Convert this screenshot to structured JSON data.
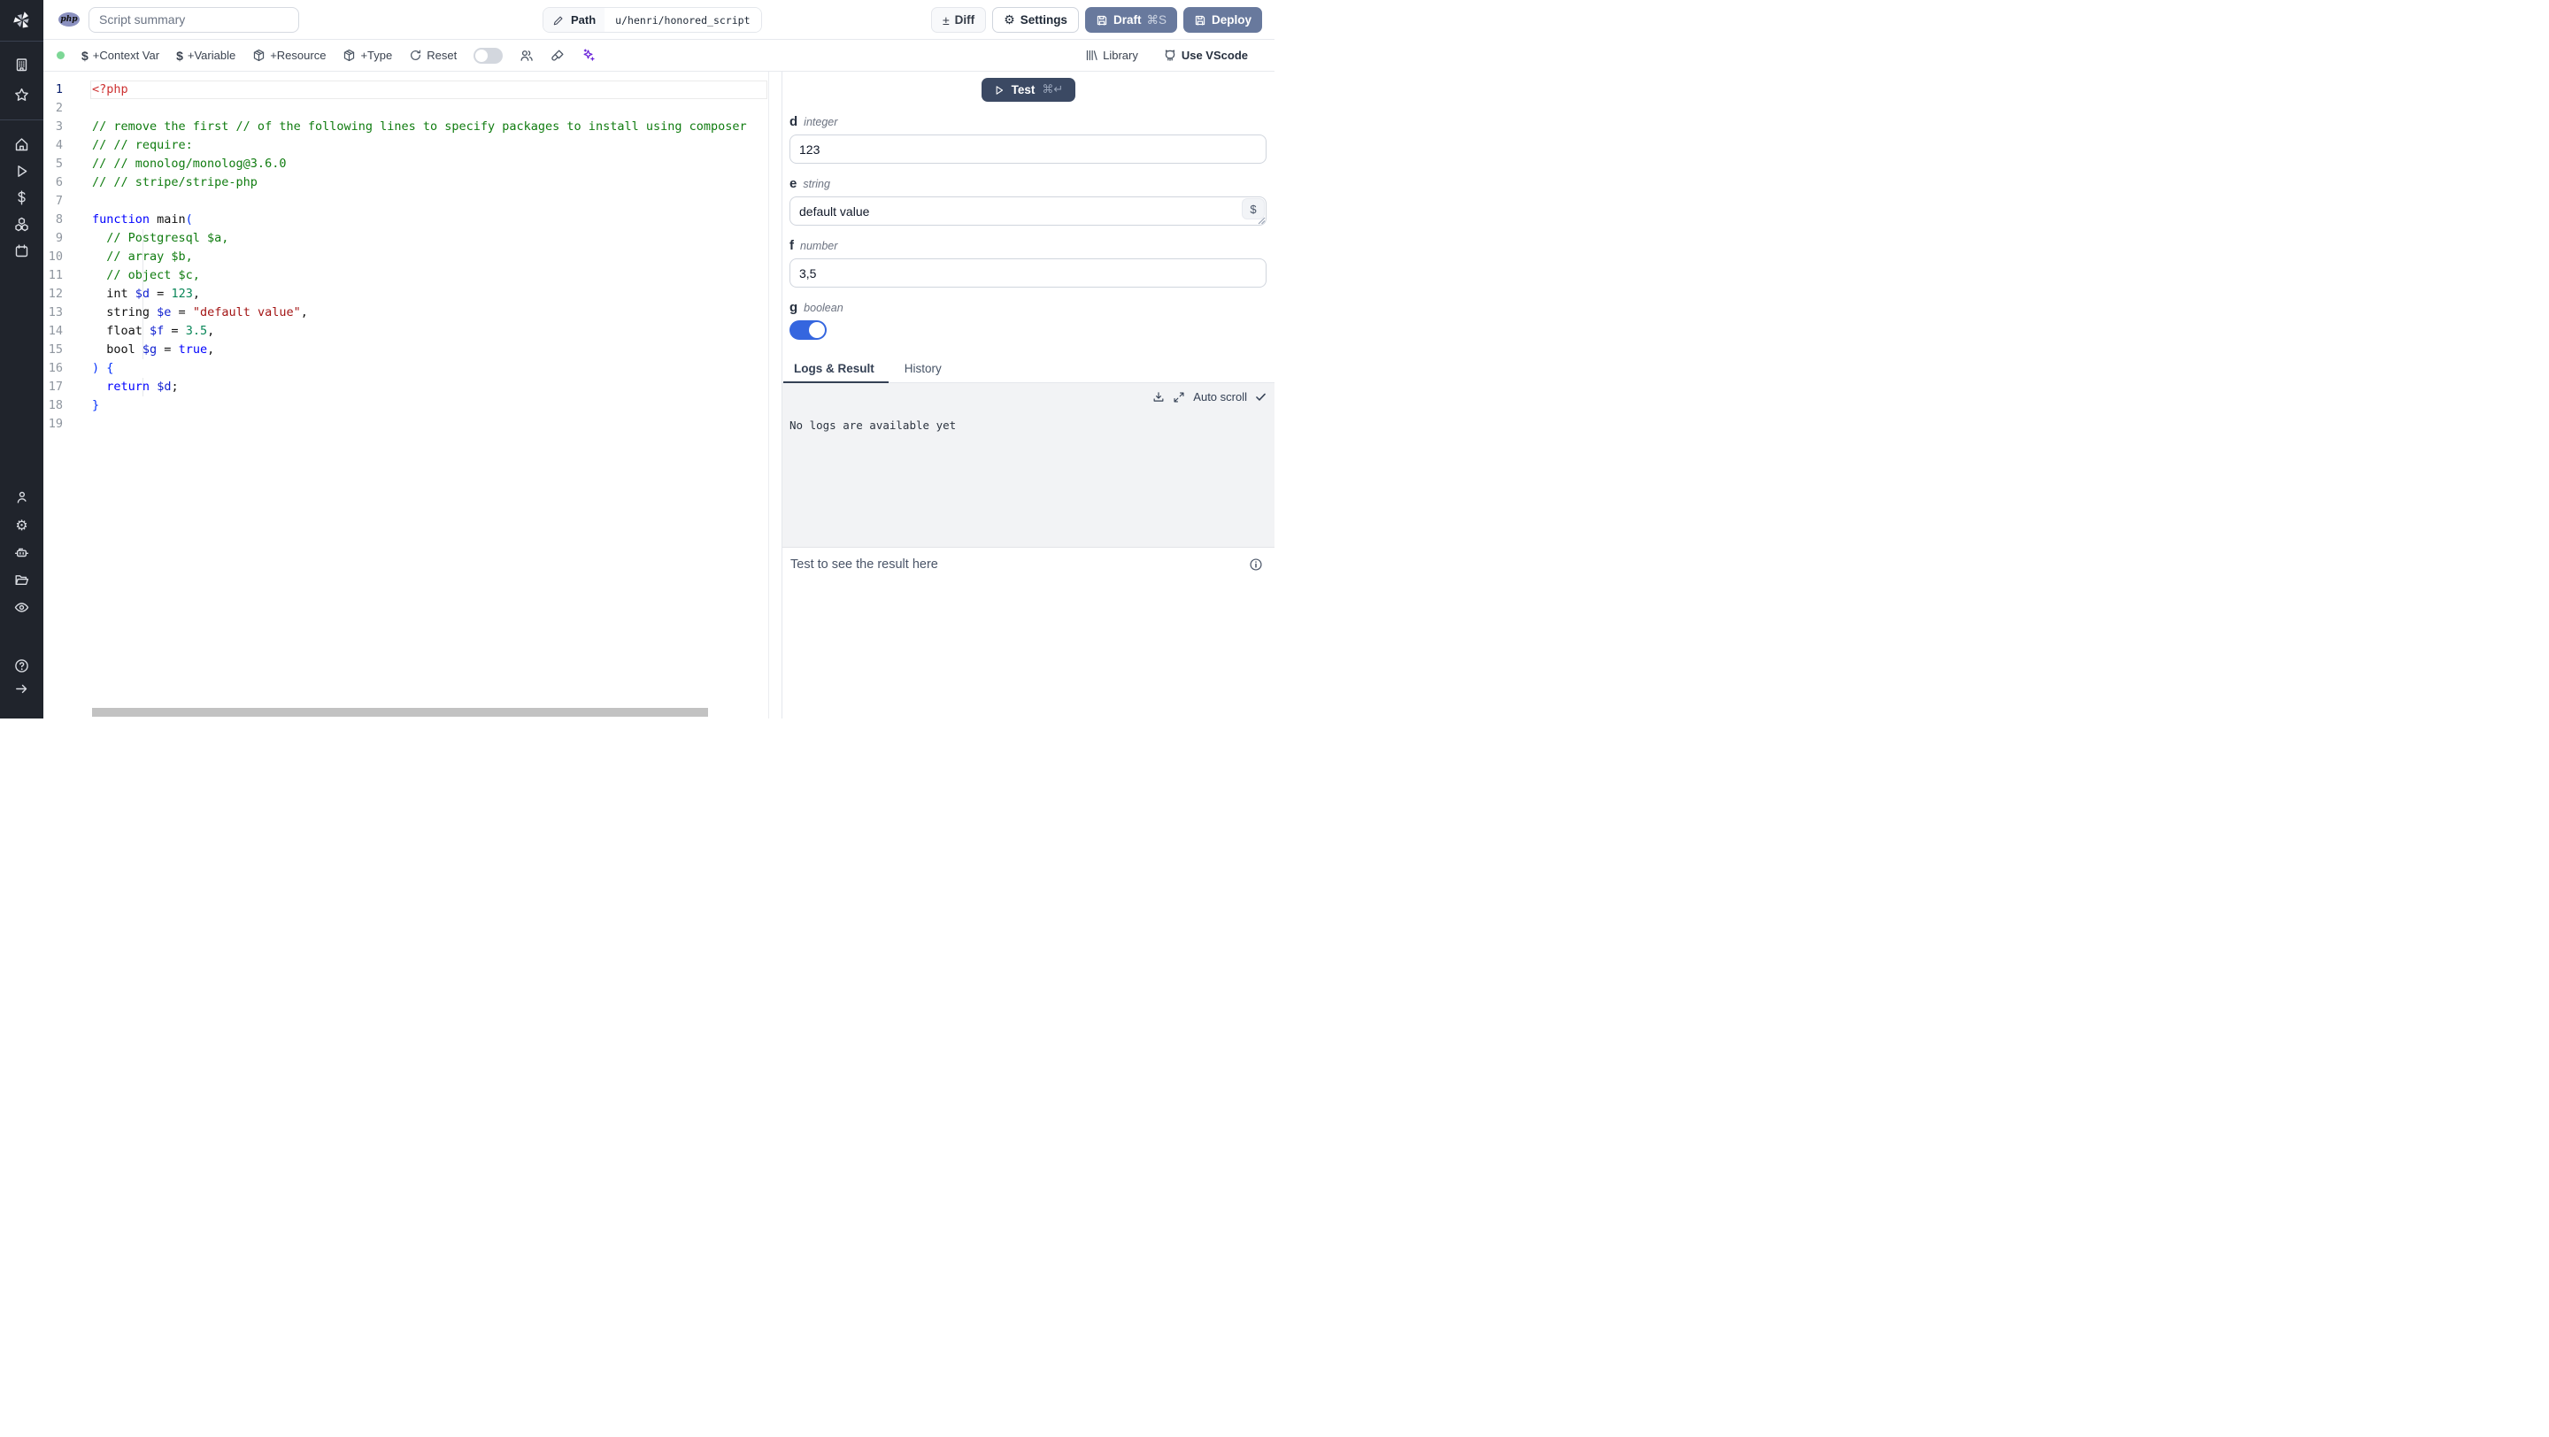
{
  "header": {
    "language_badge": "php",
    "summary_placeholder": "Script summary",
    "path_label": "Path",
    "path_value": "u/henri/honored_script",
    "diff_label": "Diff",
    "settings_label": "Settings",
    "draft_label": "Draft",
    "draft_shortcut": "⌘S",
    "deploy_label": "Deploy"
  },
  "toolbar": {
    "add_context_var": "+Context Var",
    "add_variable": "+Variable",
    "add_resource": "+Resource",
    "add_type": "+Type",
    "reset": "Reset",
    "library": "Library",
    "use_vscode": "Use VScode"
  },
  "sidebar": {
    "icons": [
      "windmill-logo",
      "workspace-building",
      "favorites-star",
      "home",
      "runs-play",
      "variables-dollar",
      "resources-cubes",
      "schedules-calendar",
      "user",
      "settings-gear",
      "workers-robot",
      "folders",
      "audit-eye",
      "help-question",
      "collapse-arrow-right"
    ]
  },
  "editor": {
    "language": "php",
    "lines": [
      {
        "n": 1,
        "s": [
          [
            "<?php",
            "tag"
          ]
        ]
      },
      {
        "n": 2,
        "s": []
      },
      {
        "n": 3,
        "s": [
          [
            "// remove the first // of the following lines to specify packages to install using composer",
            "cm"
          ]
        ]
      },
      {
        "n": 4,
        "s": [
          [
            "// // require:",
            "cm"
          ]
        ]
      },
      {
        "n": 5,
        "s": [
          [
            "// // monolog/monolog@3.6.0",
            "cm"
          ]
        ]
      },
      {
        "n": 6,
        "s": [
          [
            "// // stripe/stripe-php",
            "cm"
          ]
        ]
      },
      {
        "n": 7,
        "s": []
      },
      {
        "n": 8,
        "s": [
          [
            "function",
            "kw"
          ],
          [
            " main",
            "pl"
          ],
          [
            "(",
            "br"
          ]
        ]
      },
      {
        "n": 9,
        "s": [
          [
            "  // Postgresql $a,",
            "cm"
          ]
        ]
      },
      {
        "n": 10,
        "s": [
          [
            "  // array $b,",
            "cm"
          ]
        ]
      },
      {
        "n": 11,
        "s": [
          [
            "  // object $c,",
            "cm"
          ]
        ]
      },
      {
        "n": 12,
        "s": [
          [
            "  int ",
            "pl"
          ],
          [
            "$d",
            "vr"
          ],
          [
            " = ",
            "pl"
          ],
          [
            "123",
            "nm"
          ],
          [
            ",",
            "pl"
          ]
        ]
      },
      {
        "n": 13,
        "s": [
          [
            "  string ",
            "pl"
          ],
          [
            "$e",
            "vr"
          ],
          [
            " = ",
            "pl"
          ],
          [
            "\"default value\"",
            "st"
          ],
          [
            ",",
            "pl"
          ]
        ]
      },
      {
        "n": 14,
        "s": [
          [
            "  float ",
            "pl"
          ],
          [
            "$f",
            "vr"
          ],
          [
            " = ",
            "pl"
          ],
          [
            "3.5",
            "nm"
          ],
          [
            ",",
            "pl"
          ]
        ]
      },
      {
        "n": 15,
        "s": [
          [
            "  bool ",
            "pl"
          ],
          [
            "$g",
            "vr"
          ],
          [
            " = ",
            "pl"
          ],
          [
            "true",
            "kw"
          ],
          [
            ",",
            "pl"
          ]
        ]
      },
      {
        "n": 16,
        "s": [
          [
            ") {",
            "br"
          ]
        ]
      },
      {
        "n": 17,
        "s": [
          [
            "  ",
            "pl"
          ],
          [
            "return",
            "kw"
          ],
          [
            " ",
            "pl"
          ],
          [
            "$d",
            "vr"
          ],
          [
            ";",
            "pl"
          ]
        ]
      },
      {
        "n": 18,
        "s": [
          [
            "}",
            "br"
          ]
        ]
      },
      {
        "n": 19,
        "s": []
      }
    ]
  },
  "run_panel": {
    "test_label": "Test",
    "test_shortcut": "⌘↵",
    "fields": [
      {
        "name": "d",
        "type": "integer",
        "value": "123"
      },
      {
        "name": "e",
        "type": "string",
        "value": "default value",
        "chip": "$"
      },
      {
        "name": "f",
        "type": "number",
        "value": "3,5"
      },
      {
        "name": "g",
        "type": "boolean",
        "value": true
      }
    ],
    "tabs": [
      {
        "label": "Logs & Result",
        "active": true
      },
      {
        "label": "History",
        "active": false
      }
    ],
    "logs": {
      "auto_scroll_label": "Auto scroll",
      "empty_text": "No logs are available yet"
    },
    "result_placeholder": "Test to see the result here"
  },
  "colors": {
    "sidebar_bg": "#20242c",
    "primary_button_slate": "#68799d",
    "test_button_navy": "#3b4963",
    "toggle_on_blue": "#3566df",
    "ai_purple": "#6d28d9",
    "status_green": "#7dd796",
    "code": {
      "comment": "#107c10",
      "keyword": "#0000ff",
      "variable": "#0f1fd0",
      "number": "#098658",
      "string": "#a31515",
      "php_tag": "#cd3131",
      "bracket": "#0431fa"
    }
  }
}
